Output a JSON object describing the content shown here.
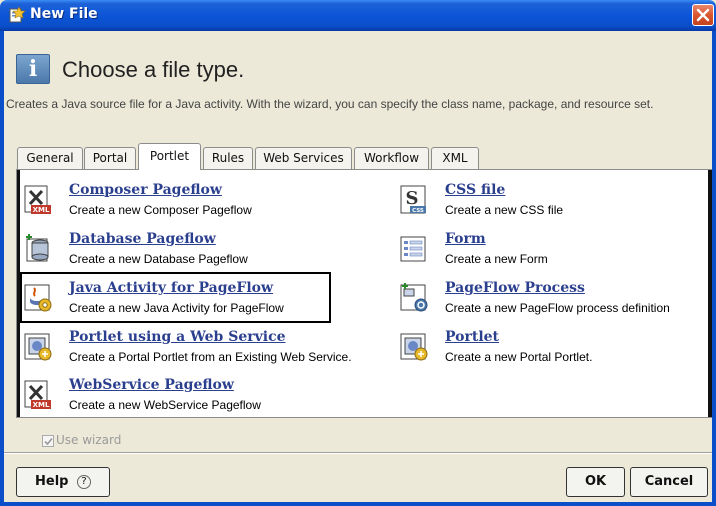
{
  "window": {
    "title": "New File",
    "title_icon": "new-file-wizard-icon",
    "close_icon": "close-icon"
  },
  "header": {
    "icon": "info-icon",
    "icon_glyph": "i",
    "heading": "Choose a file type.",
    "description": "Creates a Java source file for a Java activity. With the wizard, you can specify the class name, package, and resource set."
  },
  "tabs": [
    {
      "label": "General",
      "active": false
    },
    {
      "label": "Portal",
      "active": false
    },
    {
      "label": "Portlet",
      "active": true
    },
    {
      "label": "Rules",
      "active": false
    },
    {
      "label": "Web Services",
      "active": false
    },
    {
      "label": "Workflow",
      "active": false
    },
    {
      "label": "XML",
      "active": false
    }
  ],
  "file_types": [
    {
      "label": "Composer Pageflow",
      "desc": "Create a new Composer Pageflow",
      "icon": "xml-document-icon"
    },
    {
      "label": "Database Pageflow",
      "desc": "Create a new Database Pageflow",
      "icon": "database-pageflow-icon"
    },
    {
      "label": "Java Activity for PageFlow",
      "desc": "Create a new Java Activity for PageFlow",
      "icon": "java-activity-icon",
      "selected": true
    },
    {
      "label": "Portlet using a Web Service",
      "desc": "Create a Portal Portlet from an Existing Web Service.",
      "icon": "portlet-web-service-icon"
    },
    {
      "label": "WebService Pageflow",
      "desc": "Create a new WebService Pageflow",
      "icon": "xml-document-icon"
    },
    {
      "label": "CSS file",
      "desc": "Create a new CSS file",
      "icon": "css-file-icon"
    },
    {
      "label": "Form",
      "desc": "Create a new Form",
      "icon": "form-icon"
    },
    {
      "label": "PageFlow Process",
      "desc": "Create a new PageFlow process definition",
      "icon": "pageflow-process-icon"
    },
    {
      "label": "Portlet",
      "desc": "Create a new Portal Portlet.",
      "icon": "portlet-icon"
    }
  ],
  "xml_badge": "XML",
  "css_badge": "CSS",
  "wizard": {
    "label": "Use wizard",
    "checked": true,
    "enabled": false
  },
  "buttons": {
    "help": "Help",
    "help_glyph": "?",
    "ok": "OK",
    "cancel": "Cancel"
  },
  "colors": {
    "title_bar": "#0a4ec9",
    "link": "#2b3f8f",
    "close": "#d8572f"
  }
}
